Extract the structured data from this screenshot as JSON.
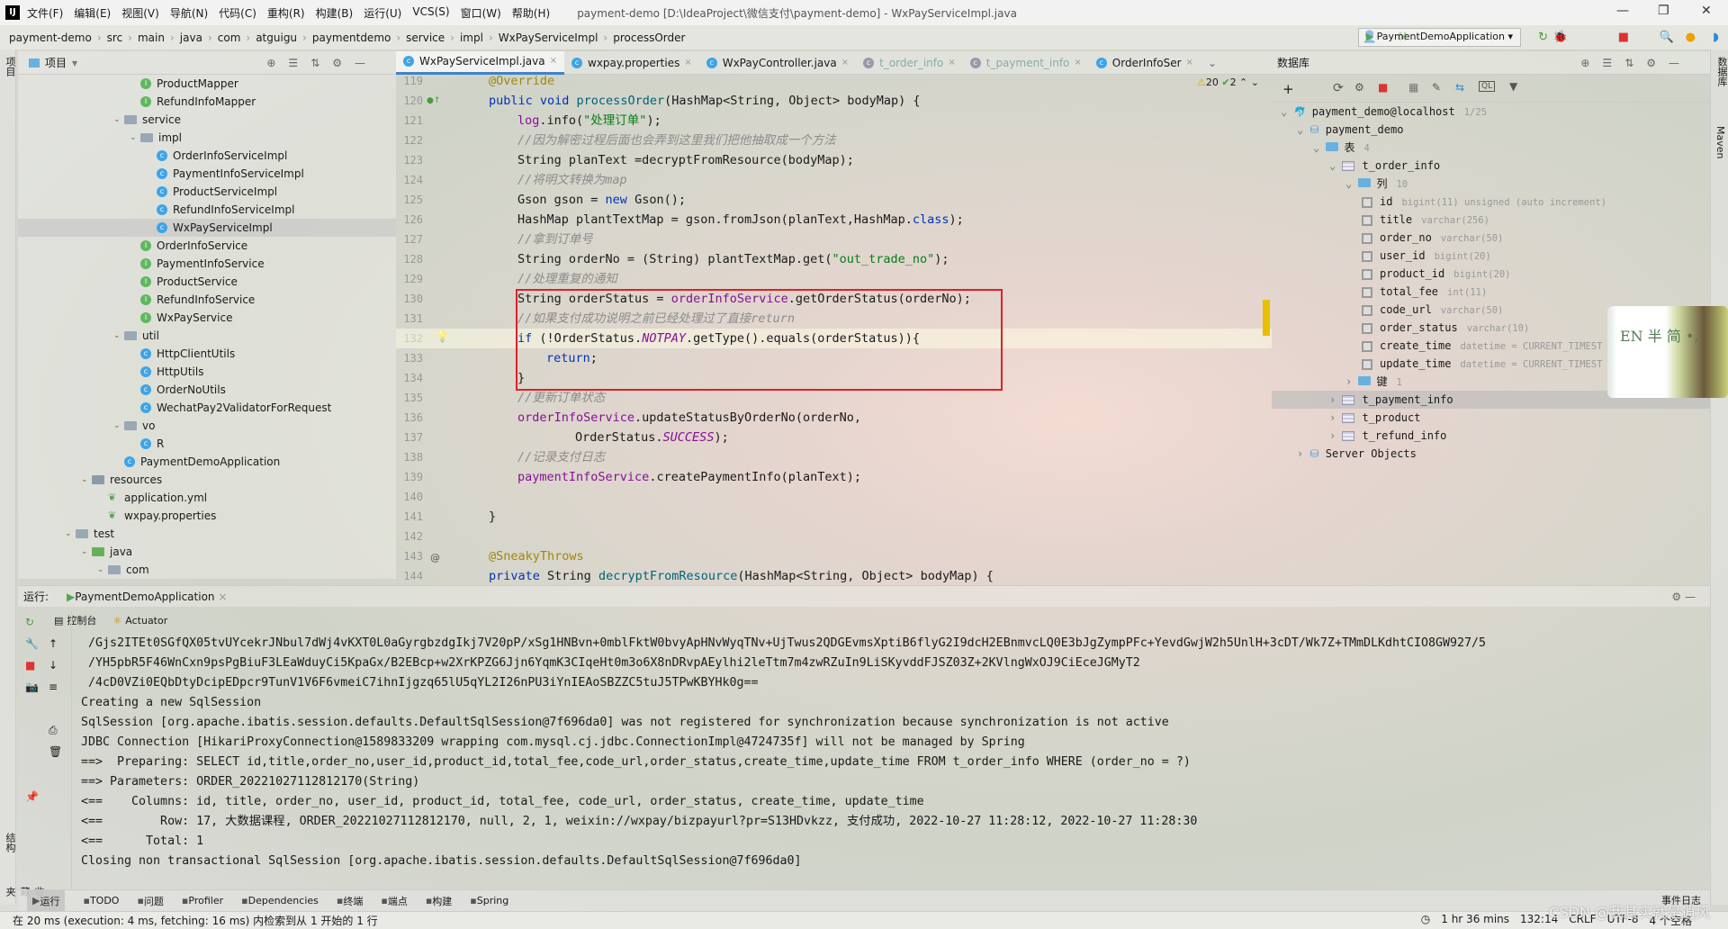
{
  "menu": {
    "items": [
      "文件(F)",
      "编辑(E)",
      "视图(V)",
      "导航(N)",
      "代码(C)",
      "重构(R)",
      "构建(B)",
      "运行(U)",
      "VCS(S)",
      "窗口(W)",
      "帮助(H)"
    ],
    "title": "payment-demo [D:\\IdeaProject\\微信支付\\payment-demo] - WxPayServiceImpl.java"
  },
  "breadcrumbs": [
    "payment-demo",
    "src",
    "main",
    "java",
    "com",
    "atguigu",
    "paymentdemo",
    "service",
    "impl",
    "WxPayServiceImpl",
    "processOrder"
  ],
  "run_config": "PaymentDemoApplication",
  "project": {
    "header": "项目",
    "tree": [
      {
        "label": "ProductMapper",
        "icon": "interface",
        "depth": 3
      },
      {
        "label": "RefundInfoMapper",
        "icon": "interface",
        "depth": 3
      },
      {
        "label": "service",
        "icon": "folder",
        "depth": 2,
        "expanded": true
      },
      {
        "label": "impl",
        "icon": "folder",
        "depth": 3,
        "expanded": true
      },
      {
        "label": "OrderInfoServiceImpl",
        "icon": "class",
        "depth": 4
      },
      {
        "label": "PaymentInfoServiceImpl",
        "icon": "class",
        "depth": 4
      },
      {
        "label": "ProductServiceImpl",
        "icon": "class",
        "depth": 4
      },
      {
        "label": "RefundInfoServiceImpl",
        "icon": "class",
        "depth": 4
      },
      {
        "label": "WxPayServiceImpl",
        "icon": "class",
        "depth": 4,
        "selected": true
      },
      {
        "label": "OrderInfoService",
        "icon": "interface",
        "depth": 3
      },
      {
        "label": "PaymentInfoService",
        "icon": "interface",
        "depth": 3
      },
      {
        "label": "ProductService",
        "icon": "interface",
        "depth": 3
      },
      {
        "label": "RefundInfoService",
        "icon": "interface",
        "depth": 3
      },
      {
        "label": "WxPayService",
        "icon": "interface",
        "depth": 3
      },
      {
        "label": "util",
        "icon": "folder",
        "depth": 2,
        "expanded": true
      },
      {
        "label": "HttpClientUtils",
        "icon": "class",
        "depth": 3
      },
      {
        "label": "HttpUtils",
        "icon": "class",
        "depth": 3
      },
      {
        "label": "OrderNoUtils",
        "icon": "class",
        "depth": 3
      },
      {
        "label": "WechatPay2ValidatorForRequest",
        "icon": "class",
        "depth": 3
      },
      {
        "label": "vo",
        "icon": "folder",
        "depth": 2,
        "expanded": true
      },
      {
        "label": "R",
        "icon": "class",
        "depth": 3
      },
      {
        "label": "PaymentDemoApplication",
        "icon": "class",
        "depth": 2
      },
      {
        "label": "resources",
        "icon": "folder-res",
        "depth": 0,
        "expanded": true
      },
      {
        "label": "application.yml",
        "icon": "leaf",
        "depth": 1
      },
      {
        "label": "wxpay.properties",
        "icon": "leaf",
        "depth": 1
      },
      {
        "label": "test",
        "icon": "folder",
        "depth": -1,
        "expanded": true
      },
      {
        "label": "java",
        "icon": "folder-src",
        "depth": 0,
        "expanded": true
      },
      {
        "label": "com",
        "icon": "folder",
        "depth": 1,
        "expanded": true
      }
    ]
  },
  "tabs": [
    {
      "label": "WxPayServiceImpl.java",
      "active": true
    },
    {
      "label": "wxpay.properties"
    },
    {
      "label": "WxPayController.java"
    },
    {
      "label": "t_order_info",
      "dim": true
    },
    {
      "label": "t_payment_info",
      "dim": true
    },
    {
      "label": "OrderInfoSer"
    }
  ],
  "inspections": {
    "warnings": "20",
    "ok": "2"
  },
  "code": [
    {
      "n": "119",
      "seg": [
        [
          "@Override",
          "an"
        ]
      ],
      "indent": 0
    },
    {
      "n": "120",
      "seg": [
        [
          "public void ",
          "kw"
        ],
        [
          "processOrder",
          "fn"
        ],
        [
          "(HashMap<String, Object> bodyMap) {",
          ""
        ]
      ],
      "indent": 0
    },
    {
      "n": "121",
      "seg": [
        [
          "log",
          "fld"
        ],
        [
          ".info(",
          ""
        ],
        [
          "\"处理订单\"",
          "str"
        ],
        [
          ");",
          ""
        ]
      ],
      "indent": 1
    },
    {
      "n": "122",
      "seg": [
        [
          "//因为解密过程后面也会弄到这里我们把他抽取成一个方法",
          "cm"
        ]
      ],
      "indent": 1
    },
    {
      "n": "123",
      "seg": [
        [
          "String planText =decryptFromResource(bodyMap);",
          ""
        ]
      ],
      "indent": 1
    },
    {
      "n": "124",
      "seg": [
        [
          "//将明文转换为map",
          "cm"
        ]
      ],
      "indent": 1
    },
    {
      "n": "125",
      "seg": [
        [
          "Gson gson = ",
          ""
        ],
        [
          "new",
          "kw"
        ],
        [
          " Gson();",
          ""
        ]
      ],
      "indent": 1
    },
    {
      "n": "126",
      "seg": [
        [
          "HashMap plantTextMap = gson.fromJson(planText,HashMap.",
          ""
        ],
        [
          "class",
          "kw"
        ],
        [
          ");",
          ""
        ]
      ],
      "indent": 1
    },
    {
      "n": "127",
      "seg": [
        [
          "//拿到订单号",
          "cm"
        ]
      ],
      "indent": 1
    },
    {
      "n": "128",
      "seg": [
        [
          "String orderNo = (String) plantTextMap.get(",
          ""
        ],
        [
          "\"out_trade_no\"",
          "str"
        ],
        [
          ");",
          ""
        ]
      ],
      "indent": 1
    },
    {
      "n": "129",
      "seg": [
        [
          "//处理重复的通知",
          "cm"
        ]
      ],
      "indent": 1
    },
    {
      "n": "130",
      "seg": [
        [
          "String orderStatus = ",
          ""
        ],
        [
          "orderInfoService",
          "fld"
        ],
        [
          ".getOrderStatus(orderNo);",
          ""
        ]
      ],
      "indent": 1
    },
    {
      "n": "131",
      "seg": [
        [
          "//如果支付成功说明之前已经处理过了直接return",
          "cm"
        ]
      ],
      "indent": 1
    },
    {
      "n": "132",
      "seg": [
        [
          "if",
          "kw"
        ],
        [
          " (!OrderStatus.",
          ""
        ],
        [
          "NOTPAY",
          "it"
        ],
        [
          ".getType().equals(orderStatus)){",
          ""
        ]
      ],
      "indent": 1,
      "current": true
    },
    {
      "n": "133",
      "seg": [
        [
          "return",
          "kw"
        ],
        [
          ";",
          ""
        ]
      ],
      "indent": 2
    },
    {
      "n": "134",
      "seg": [
        [
          "}",
          ""
        ]
      ],
      "indent": 1
    },
    {
      "n": "135",
      "seg": [
        [
          "//更新订单状态",
          "cm"
        ]
      ],
      "indent": 1
    },
    {
      "n": "136",
      "seg": [
        [
          "orderInfoService",
          "fld"
        ],
        [
          ".updateStatusByOrderNo(orderNo,",
          ""
        ]
      ],
      "indent": 1
    },
    {
      "n": "137",
      "seg": [
        [
          "OrderStatus.",
          ""
        ],
        [
          "SUCCESS",
          "it"
        ],
        [
          ");",
          ""
        ]
      ],
      "indent": 3
    },
    {
      "n": "138",
      "seg": [
        [
          "//记录支付日志",
          "cm"
        ]
      ],
      "indent": 1
    },
    {
      "n": "139",
      "seg": [
        [
          "paymentInfoService",
          "fld"
        ],
        [
          ".createPaymentInfo(planText);",
          ""
        ]
      ],
      "indent": 1
    },
    {
      "n": "140",
      "seg": [],
      "indent": 0
    },
    {
      "n": "141",
      "seg": [
        [
          "}",
          ""
        ]
      ],
      "indent": 0
    },
    {
      "n": "142",
      "seg": [],
      "indent": 0
    },
    {
      "n": "143",
      "seg": [
        [
          "@SneakyThrows",
          "an"
        ]
      ],
      "indent": 0
    },
    {
      "n": "144",
      "seg": [
        [
          "private ",
          "kw"
        ],
        [
          "String ",
          ""
        ],
        [
          "decryptFromResource",
          "fn"
        ],
        [
          "(HashMap<String, Object> bodyMap) {",
          ""
        ]
      ],
      "indent": 0
    }
  ],
  "database": {
    "header": "数据库",
    "tree": [
      {
        "label": "payment_demo@localhost",
        "type": "1/25",
        "depth": 0,
        "kind": "conn"
      },
      {
        "label": "payment_demo",
        "depth": 1,
        "kind": "schema"
      },
      {
        "label": "表",
        "type": "4",
        "depth": 2,
        "kind": "folder"
      },
      {
        "label": "t_order_info",
        "depth": 3,
        "kind": "table"
      },
      {
        "label": "列",
        "type": "10",
        "depth": 4,
        "kind": "folder"
      },
      {
        "label": "id",
        "type": "bigint(11) unsigned (auto increment)",
        "depth": 5,
        "kind": "col"
      },
      {
        "label": "title",
        "type": "varchar(256)",
        "depth": 5,
        "kind": "col"
      },
      {
        "label": "order_no",
        "type": "varchar(50)",
        "depth": 5,
        "kind": "col"
      },
      {
        "label": "user_id",
        "type": "bigint(20)",
        "depth": 5,
        "kind": "col"
      },
      {
        "label": "product_id",
        "type": "bigint(20)",
        "depth": 5,
        "kind": "col"
      },
      {
        "label": "total_fee",
        "type": "int(11)",
        "depth": 5,
        "kind": "col"
      },
      {
        "label": "code_url",
        "type": "varchar(50)",
        "depth": 5,
        "kind": "col"
      },
      {
        "label": "order_status",
        "type": "varchar(10)",
        "depth": 5,
        "kind": "col"
      },
      {
        "label": "create_time",
        "type": "datetime = CURRENT_TIMEST",
        "depth": 5,
        "kind": "col"
      },
      {
        "label": "update_time",
        "type": "datetime = CURRENT_TIMEST",
        "depth": 5,
        "kind": "col"
      },
      {
        "label": "键",
        "type": "1",
        "depth": 4,
        "kind": "folder"
      },
      {
        "label": "t_payment_info",
        "depth": 3,
        "kind": "table",
        "selected": true
      },
      {
        "label": "t_product",
        "depth": 3,
        "kind": "table"
      },
      {
        "label": "t_refund_info",
        "depth": 3,
        "kind": "table"
      },
      {
        "label": "Server Objects",
        "depth": 1,
        "kind": "schema"
      }
    ]
  },
  "avatar_text": "EN 半 简 •,",
  "run": {
    "label": "运行:",
    "config": "PaymentDemoApplication",
    "subtabs": [
      "控制台",
      "Actuator"
    ]
  },
  "console": [
    " /Gjs2ITEt0SGfQX05tvUYcekrJNbul7dWj4vKXT0L0aGyrgbzdgIkj7V20pP/xSg1HNBvn+0mblFktW0bvyApHNvWyqTNv+UjTwus2QDGEvmsXptiB6flyG2I9dcH2EBnmvcLQ0E3bJgZympPFc+YevdGwjW2h5UnlH+3cDT/Wk7Z+TMmDLKdhtCIO8GW927/5",
    " /YH5pbR5F46WnCxn9psPgBiuF3LEaWduyCi5KpaGx/B2EBcp+w2XrKPZG6Jjn6YqmK3CIqeHt0m3o6X8nDRvpAEylhi2leTtm7m4zwRZuIn9LiSKyvddFJSZ03Z+2KVlngWxOJ9CiEceJGMyT2",
    " /4cD0VZi0EQbDtyDcipEDpcr9TunV1V6F6vmeiC7ihnIjgzq65lU5qYL2I26nPU3iYnIEAoSBZZC5tuJ5TPwKBYHk0g==",
    "Creating a new SqlSession",
    "SqlSession [org.apache.ibatis.session.defaults.DefaultSqlSession@7f696da0] was not registered for synchronization because synchronization is not active",
    "JDBC Connection [HikariProxyConnection@1589833209 wrapping com.mysql.cj.jdbc.ConnectionImpl@4724735f] will not be managed by Spring",
    "==>  Preparing: SELECT id,title,order_no,user_id,product_id,total_fee,code_url,order_status,create_time,update_time FROM t_order_info WHERE (order_no = ?)",
    "==> Parameters: ORDER_20221027112812170(String)",
    "<==    Columns: id, title, order_no, user_id, product_id, total_fee, code_url, order_status, create_time, update_time",
    "<==        Row: 17, 大数据课程, ORDER_20221027112812170, null, 2, 1, weixin://wxpay/bizpayurl?pr=S13HDvkzz, 支付成功, 2022-10-27 11:28:12, 2022-10-27 11:28:30",
    "<==      Total: 1",
    "Closing non transactional SqlSession [org.apache.ibatis.session.defaults.DefaultSqlSession@7f696da0]"
  ],
  "toolwindows": [
    "运行",
    "TODO",
    "问题",
    "Profiler",
    "Dependencies",
    "终端",
    "端点",
    "构建",
    "Spring"
  ],
  "event_log": "事件日志",
  "status": {
    "message": "在 20 ms (execution: 4 ms, fetching: 16 ms) 内检索到从 1 开始的 1 行",
    "time": "1 hr 36 mins",
    "position": "132:14",
    "line_sep": "CRLF",
    "encoding": "UTF-8",
    "indent": "4 个空格"
  },
  "watermark": "CSDN @我其实就是逍风",
  "side_labels": {
    "left_top": "项目",
    "right_top": "数据库",
    "right_maven": "Maven",
    "left_structure": "结构",
    "left_bookmarks": "收藏夹"
  }
}
